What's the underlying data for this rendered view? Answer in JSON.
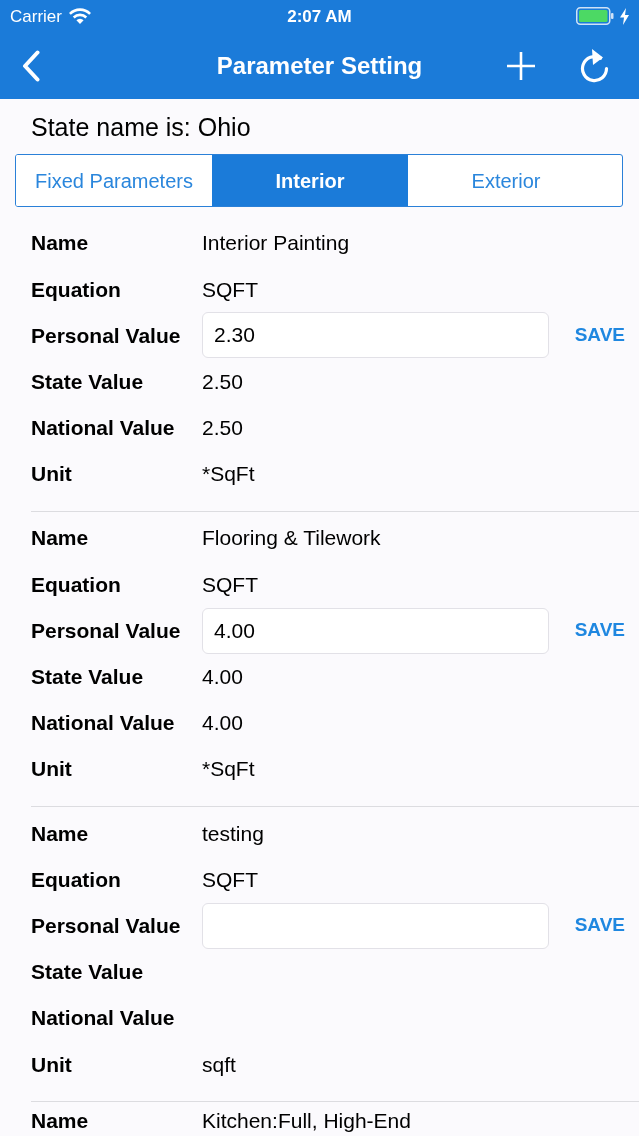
{
  "status_bar": {
    "carrier": "Carrier",
    "time": "2:07 AM",
    "charging": true
  },
  "nav_bar": {
    "title": "Parameter Setting"
  },
  "state_label": "State name is: Ohio",
  "tabs": [
    {
      "label": "Fixed Parameters",
      "selected": false
    },
    {
      "label": "Interior",
      "selected": true
    },
    {
      "label": "Exterior",
      "selected": false
    }
  ],
  "parameters": [
    {
      "rows": [
        {
          "kind": "text",
          "label": "Name",
          "value": "Interior Painting"
        },
        {
          "kind": "text",
          "label": "Equation",
          "value": "SQFT"
        },
        {
          "kind": "input",
          "label": "Personal Value",
          "value": "2.30",
          "action": "SAVE"
        },
        {
          "kind": "text",
          "label": "State Value",
          "value": "2.50"
        },
        {
          "kind": "text",
          "label": "National Value",
          "value": "2.50"
        },
        {
          "kind": "text",
          "label": "Unit",
          "value": "*SqFt"
        }
      ]
    },
    {
      "rows": [
        {
          "kind": "text",
          "label": "Name",
          "value": "Flooring & Tilework"
        },
        {
          "kind": "text",
          "label": "Equation",
          "value": "SQFT"
        },
        {
          "kind": "input",
          "label": "Personal Value",
          "value": "4.00",
          "action": "SAVE"
        },
        {
          "kind": "text",
          "label": "State Value",
          "value": "4.00"
        },
        {
          "kind": "text",
          "label": "National Value",
          "value": "4.00"
        },
        {
          "kind": "text",
          "label": "Unit",
          "value": "*SqFt"
        }
      ]
    },
    {
      "rows": [
        {
          "kind": "text",
          "label": "Name",
          "value": "testing"
        },
        {
          "kind": "text",
          "label": "Equation",
          "value": "SQFT"
        },
        {
          "kind": "input",
          "label": "Personal Value",
          "action": "SAVE"
        },
        {
          "kind": "text",
          "label": "State Value"
        },
        {
          "kind": "text",
          "label": "National Value"
        },
        {
          "kind": "text",
          "label": "Unit",
          "value": "sqft"
        }
      ]
    },
    {
      "rows": [
        {
          "kind": "text",
          "label": "Name",
          "value": "Kitchen:Full, High-End"
        }
      ]
    }
  ]
}
